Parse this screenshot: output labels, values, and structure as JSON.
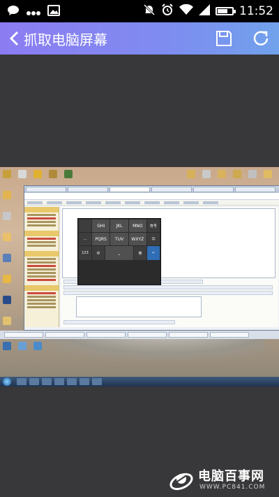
{
  "status_bar": {
    "time": "11:52",
    "battery_level": 0.65,
    "icons": [
      "chat-bubble-icon",
      "more-dots-icon",
      "image-icon",
      "mute-icon",
      "alarm-icon",
      "wifi-icon",
      "signal-icon",
      "battery-icon"
    ]
  },
  "app_bar": {
    "title": "抓取电脑屏幕",
    "icons": [
      "back-arrow-icon",
      "save-icon",
      "refresh-icon"
    ],
    "gradient": [
      "#8c7cf2",
      "#71a2ec"
    ]
  },
  "captured_screen": {
    "keypad_keys": [
      [
        "",
        "GHI",
        "JKL",
        "MNO",
        "符号"
      ],
      [
        "...",
        "PQRS",
        "TUV",
        "WXYZ",
        "☺"
      ],
      [
        "123",
        "中",
        "⎵",
        "英",
        "↵"
      ]
    ]
  },
  "watermark": {
    "title": "电脑百事网",
    "url": "WWW.PC841.COM"
  }
}
